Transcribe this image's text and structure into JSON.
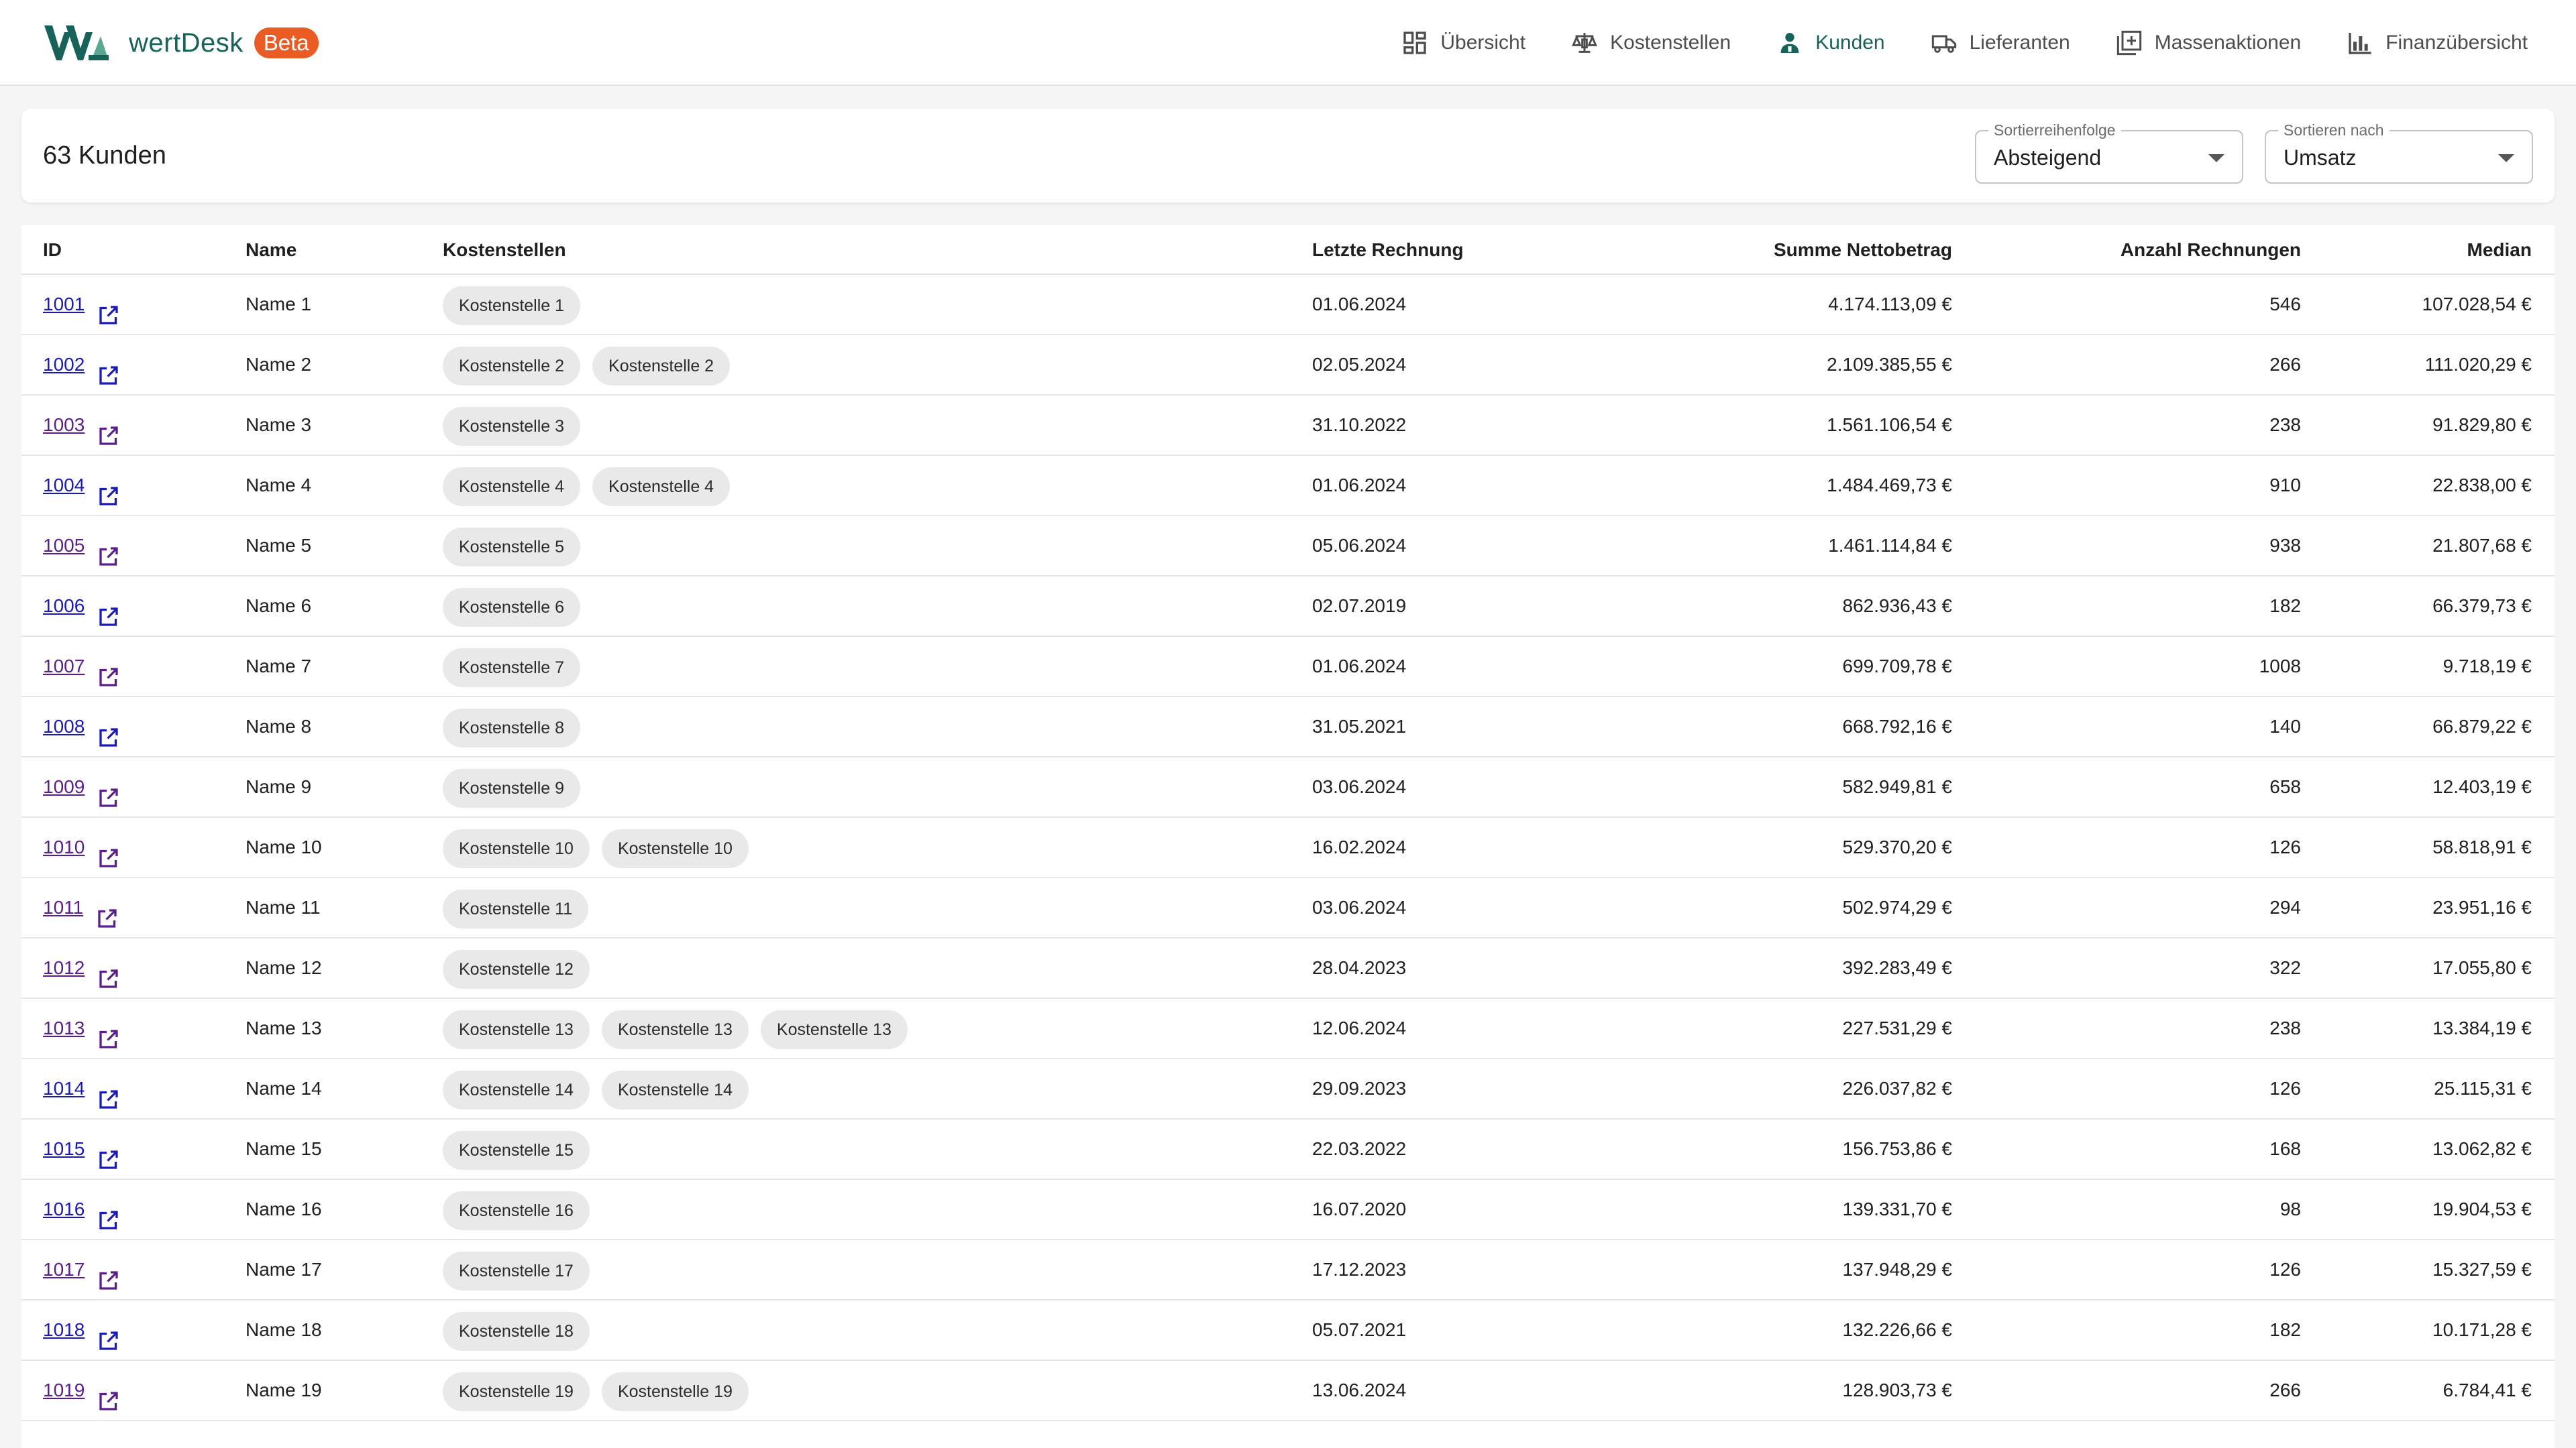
{
  "brand": {
    "name": "wertDesk",
    "badge": "Beta"
  },
  "nav": [
    {
      "label": "Übersicht",
      "icon": "dashboard-icon",
      "active": false
    },
    {
      "label": "Kostenstellen",
      "icon": "scale-icon",
      "active": false
    },
    {
      "label": "Kunden",
      "icon": "person-icon",
      "active": true
    },
    {
      "label": "Lieferanten",
      "icon": "truck-icon",
      "active": false
    },
    {
      "label": "Massenaktionen",
      "icon": "add-box-icon",
      "active": false
    },
    {
      "label": "Finanzübersicht",
      "icon": "bar-chart-icon",
      "active": false
    }
  ],
  "header": {
    "title": "63 Kunden",
    "sort_order": {
      "label": "Sortierreihenfolge",
      "value": "Absteigend"
    },
    "sort_by": {
      "label": "Sortieren nach",
      "value": "Umsatz"
    }
  },
  "table": {
    "columns": [
      "ID",
      "Name",
      "Kostenstellen",
      "Letzte Rechnung",
      "Summe Nettobetrag",
      "Anzahl Rechnungen",
      "Median"
    ],
    "rows": [
      {
        "id": "1001",
        "name": "Name 1",
        "kostenstellen": [
          "Kostenstelle 1"
        ],
        "date": "01.06.2024",
        "sum": "4.174.113,09 €",
        "count": "546",
        "median": "107.028,54 €",
        "visited": false
      },
      {
        "id": "1002",
        "name": "Name 2",
        "kostenstellen": [
          "Kostenstelle 2",
          "Kostenstelle 2"
        ],
        "date": "02.05.2024",
        "sum": "2.109.385,55 €",
        "count": "266",
        "median": "111.020,29 €",
        "visited": false
      },
      {
        "id": "1003",
        "name": "Name 3",
        "kostenstellen": [
          "Kostenstelle 3"
        ],
        "date": "31.10.2022",
        "sum": "1.561.106,54 €",
        "count": "238",
        "median": "91.829,80 €",
        "visited": true
      },
      {
        "id": "1004",
        "name": "Name 4",
        "kostenstellen": [
          "Kostenstelle 4",
          "Kostenstelle 4"
        ],
        "date": "01.06.2024",
        "sum": "1.484.469,73 €",
        "count": "910",
        "median": "22.838,00 €",
        "visited": false
      },
      {
        "id": "1005",
        "name": "Name 5",
        "kostenstellen": [
          "Kostenstelle 5"
        ],
        "date": "05.06.2024",
        "sum": "1.461.114,84 €",
        "count": "938",
        "median": "21.807,68 €",
        "visited": true
      },
      {
        "id": "1006",
        "name": "Name 6",
        "kostenstellen": [
          "Kostenstelle 6"
        ],
        "date": "02.07.2019",
        "sum": "862.936,43 €",
        "count": "182",
        "median": "66.379,73 €",
        "visited": false
      },
      {
        "id": "1007",
        "name": "Name 7",
        "kostenstellen": [
          "Kostenstelle 7"
        ],
        "date": "01.06.2024",
        "sum": "699.709,78 €",
        "count": "1008",
        "median": "9.718,19 €",
        "visited": true
      },
      {
        "id": "1008",
        "name": "Name 8",
        "kostenstellen": [
          "Kostenstelle 8"
        ],
        "date": "31.05.2021",
        "sum": "668.792,16 €",
        "count": "140",
        "median": "66.879,22 €",
        "visited": false
      },
      {
        "id": "1009",
        "name": "Name 9",
        "kostenstellen": [
          "Kostenstelle 9"
        ],
        "date": "03.06.2024",
        "sum": "582.949,81 €",
        "count": "658",
        "median": "12.403,19 €",
        "visited": true
      },
      {
        "id": "1010",
        "name": "Name 10",
        "kostenstellen": [
          "Kostenstelle 10",
          "Kostenstelle 10"
        ],
        "date": "16.02.2024",
        "sum": "529.370,20 €",
        "count": "126",
        "median": "58.818,91 €",
        "visited": true
      },
      {
        "id": "1011",
        "name": "Name 11",
        "kostenstellen": [
          "Kostenstelle 11"
        ],
        "date": "03.06.2024",
        "sum": "502.974,29 €",
        "count": "294",
        "median": "23.951,16 €",
        "visited": true
      },
      {
        "id": "1012",
        "name": "Name 12",
        "kostenstellen": [
          "Kostenstelle 12"
        ],
        "date": "28.04.2023",
        "sum": "392.283,49 €",
        "count": "322",
        "median": "17.055,80 €",
        "visited": true
      },
      {
        "id": "1013",
        "name": "Name 13",
        "kostenstellen": [
          "Kostenstelle 13",
          "Kostenstelle 13",
          "Kostenstelle 13"
        ],
        "date": "12.06.2024",
        "sum": "227.531,29 €",
        "count": "238",
        "median": "13.384,19 €",
        "visited": true
      },
      {
        "id": "1014",
        "name": "Name 14",
        "kostenstellen": [
          "Kostenstelle 14",
          "Kostenstelle 14"
        ],
        "date": "29.09.2023",
        "sum": "226.037,82 €",
        "count": "126",
        "median": "25.115,31 €",
        "visited": false
      },
      {
        "id": "1015",
        "name": "Name 15",
        "kostenstellen": [
          "Kostenstelle 15"
        ],
        "date": "22.03.2022",
        "sum": "156.753,86 €",
        "count": "168",
        "median": "13.062,82 €",
        "visited": false
      },
      {
        "id": "1016",
        "name": "Name 16",
        "kostenstellen": [
          "Kostenstelle 16"
        ],
        "date": "16.07.2020",
        "sum": "139.331,70 €",
        "count": "98",
        "median": "19.904,53 €",
        "visited": false
      },
      {
        "id": "1017",
        "name": "Name 17",
        "kostenstellen": [
          "Kostenstelle 17"
        ],
        "date": "17.12.2023",
        "sum": "137.948,29 €",
        "count": "126",
        "median": "15.327,59 €",
        "visited": true
      },
      {
        "id": "1018",
        "name": "Name 18",
        "kostenstellen": [
          "Kostenstelle 18"
        ],
        "date": "05.07.2021",
        "sum": "132.226,66 €",
        "count": "182",
        "median": "10.171,28 €",
        "visited": false
      },
      {
        "id": "1019",
        "name": "Name 19",
        "kostenstellen": [
          "Kostenstelle 19",
          "Kostenstelle 19"
        ],
        "date": "13.06.2024",
        "sum": "128.903,73 €",
        "count": "266",
        "median": "6.784,41 €",
        "visited": true
      }
    ]
  },
  "colors": {
    "brand": "#17635a",
    "badge": "#ea5c24",
    "link": "#1a1ab8",
    "link_visited": "#5a1e8c",
    "chip": "#e9e9e9"
  }
}
